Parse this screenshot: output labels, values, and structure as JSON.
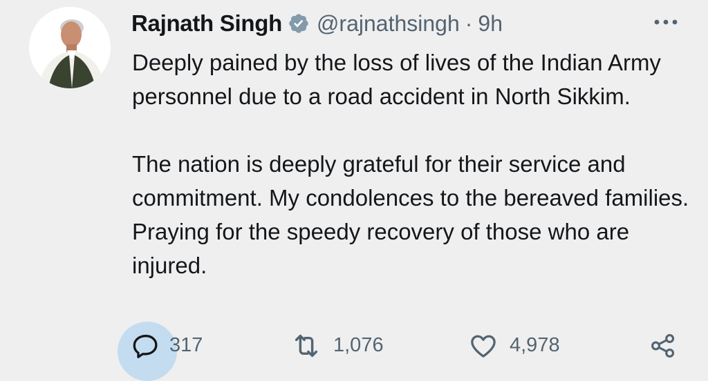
{
  "author": {
    "display_name": "Rajnath Singh",
    "handle": "@rajnathsingh",
    "separator": "·",
    "time": "9h",
    "verified": true
  },
  "tweet": {
    "paragraphs": [
      "Deeply pained by the loss of lives of the Indian Army personnel due to a road accident in North Sikkim.",
      "The nation is deeply grateful for their service and commitment. My condolences to the bereaved families. Praying for the speedy recovery of those who are injured."
    ]
  },
  "actions": {
    "replies": "317",
    "retweets": "1,076",
    "likes": "4,978"
  },
  "icons": {
    "more": "more-icon",
    "reply": "reply-icon",
    "retweet": "retweet-icon",
    "like": "heart-icon",
    "share": "share-icon",
    "verified": "verified-badge-icon"
  },
  "colors": {
    "background": "#efeff0",
    "text": "#14171a",
    "secondary_text": "#536471",
    "reply_highlight": "#c4dcef",
    "verified_badge": "#829aab"
  }
}
